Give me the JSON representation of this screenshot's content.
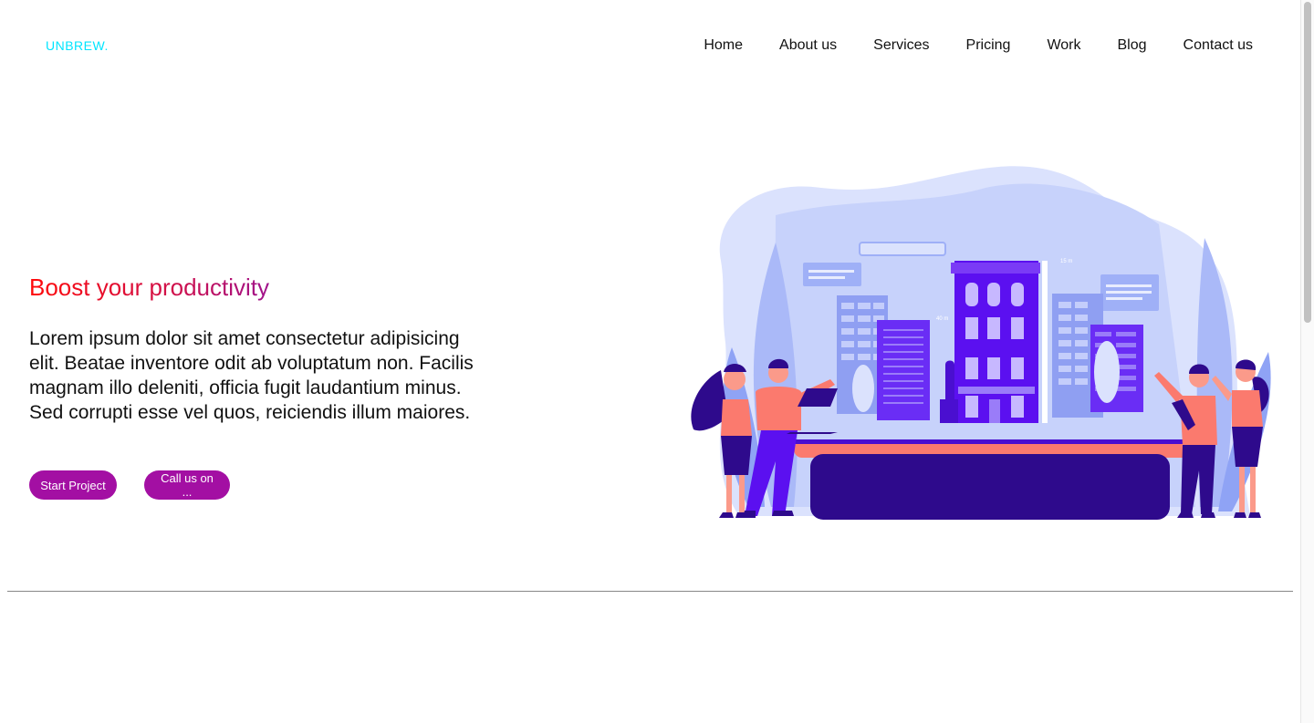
{
  "header": {
    "logo": "UNBREW.",
    "nav": [
      "Home",
      "About us",
      "Services",
      "Pricing",
      "Work",
      "Blog",
      "Contact us"
    ]
  },
  "hero": {
    "title": "Boost your productivity",
    "text": "Lorem ipsum dolor sit amet consectetur adipisicing elit. Beatae inventore odit ab voluptatum non. Facilis magnam illo deleniti, officia fugit laudantium minus. Sed corrupti esse vel quos, reiciendis illum maiores.",
    "start_button": "Start Project",
    "call_button": "Call us on ..."
  },
  "illustration": {
    "label_top": "15 m",
    "label_side": "40 m"
  },
  "colors": {
    "logo": "#00e5ff",
    "button": "#a30fa3",
    "title_start": "#ff0a0a",
    "title_end": "#a0128c",
    "building": "#5b10f0",
    "blob": "#c7d2fb",
    "coral": "#fb7a6e",
    "navy": "#2e0a8c"
  }
}
